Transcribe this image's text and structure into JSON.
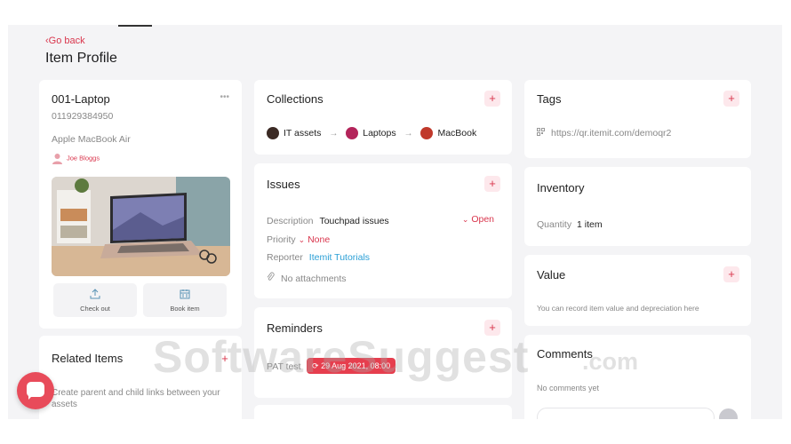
{
  "header": {
    "back_label": "Go back",
    "title": "Item Profile"
  },
  "item": {
    "name": "001-Laptop",
    "barcode": "011929384950",
    "model": "Apple MacBook Air",
    "owner": "Joe Bloggs",
    "more_label": "•••",
    "actions": {
      "check_out": "Check out",
      "book_item": "Book item"
    }
  },
  "related": {
    "title": "Related Items",
    "description": "Create parent and child links between your assets"
  },
  "collections": {
    "title": "Collections",
    "items": [
      {
        "label": "IT assets",
        "color": "#3b2a24"
      },
      {
        "label": "Laptops",
        "color": "#b3245a"
      },
      {
        "label": "MacBook",
        "color": "#c0392b"
      }
    ],
    "arrow": "→"
  },
  "issues": {
    "title": "Issues",
    "description_label": "Description",
    "description_value": "Touchpad issues",
    "status": "Open",
    "priority_label": "Priority",
    "priority_value": "None",
    "reporter_label": "Reporter",
    "reporter_value": "Itemit Tutorials",
    "attachments": "No attachments"
  },
  "reminders": {
    "title": "Reminders",
    "reminder_name": "PAT test",
    "reminder_date": "29 Aug 2021, 08:00"
  },
  "tags": {
    "title": "Tags",
    "url": "https://qr.itemit.com/demoqr2"
  },
  "inventory": {
    "title": "Inventory",
    "quantity_label": "Quantity",
    "quantity_value": "1 item"
  },
  "value": {
    "title": "Value",
    "description": "You can record item value and depreciation here"
  },
  "comments": {
    "title": "Comments",
    "empty": "No comments yet"
  },
  "watermark": {
    "text": "SoftwareSuggest",
    "suffix": ".com"
  },
  "colors": {
    "accent": "#d9364d",
    "link": "#2a9fd6",
    "background": "#f4f4f6",
    "chat": "#e84b5a"
  },
  "icons": {
    "add": "+",
    "back": "‹",
    "chevron": "⌄",
    "refresh": "⟳"
  }
}
